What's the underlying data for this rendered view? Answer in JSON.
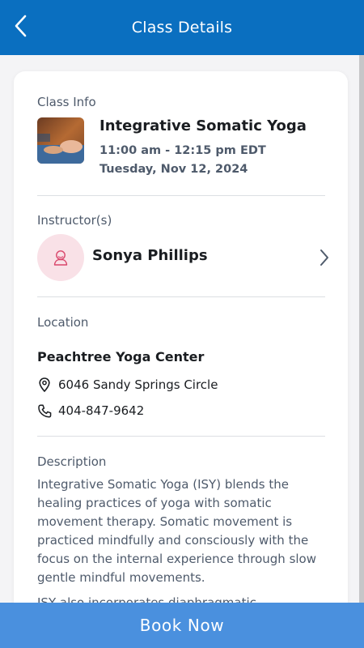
{
  "header": {
    "title": "Class Details"
  },
  "class_info": {
    "label": "Class Info",
    "name": "Integrative Somatic Yoga",
    "time": "11:00 am - 12:15 pm EDT",
    "date": "Tuesday, Nov 12, 2024"
  },
  "instructor": {
    "label": "Instructor(s)",
    "name": "Sonya Phillips"
  },
  "location": {
    "label": "Location",
    "name": "Peachtree Yoga Center",
    "address": "6046 Sandy Springs Circle",
    "phone": "404-847-9642"
  },
  "description": {
    "label": "Description",
    "paragraph1": "Integrative Somatic Yoga (ISY) blends the healing practices of yoga with somatic movement therapy. Somatic movement is practiced mindfully and consciously with the focus on the internal experience through slow gentle mindful movements.",
    "paragraph2": "ISY also incorporates diaphragmatic"
  },
  "book_button": {
    "label": "Book Now"
  },
  "colors": {
    "header_bg": "#0a6fc0",
    "book_button_bg": "#4a90de",
    "avatar_bg": "#f9e1e7",
    "avatar_icon": "#d9466b"
  },
  "icons": {
    "back": "chevron-left-icon",
    "instructor_avatar": "person-icon",
    "instructor_chevron": "chevron-right-icon",
    "address": "map-pin-icon",
    "phone": "phone-icon"
  }
}
